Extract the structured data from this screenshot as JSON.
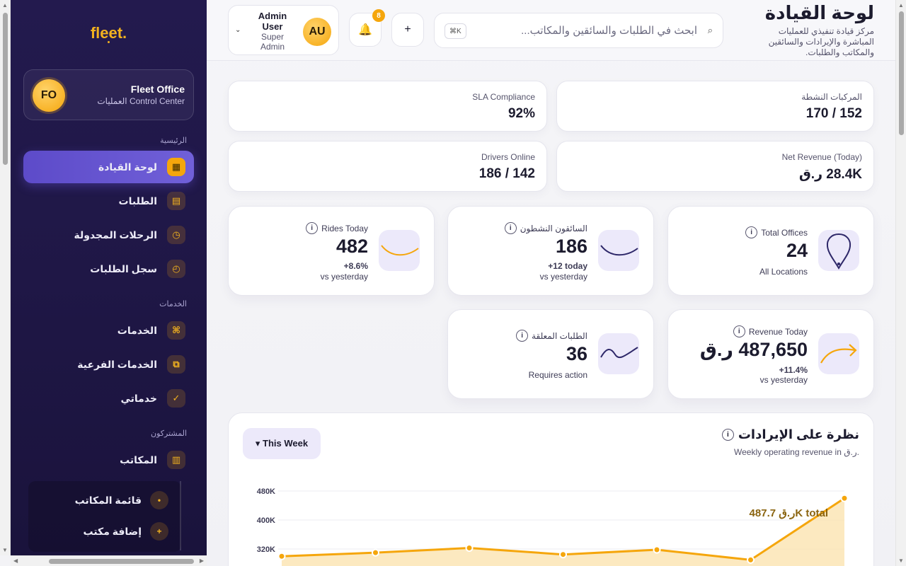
{
  "sidebar": {
    "logo": "fleet.",
    "office": {
      "initials": "FO",
      "name": "Fleet Office",
      "subtitle": "العمليات Control Center"
    },
    "sections": {
      "main": "الرئيسية",
      "services": "الخدمات",
      "subscribers": "المشتركون"
    },
    "items": {
      "dashboard": "لوحة القيادة",
      "requests": "الطلبات",
      "scheduled_trips": "الرحلات المجدولة",
      "request_log": "سجل الطلبات",
      "services": "الخدمات",
      "sub_services": "الخدمات الفرعية",
      "my_services": "خدماتي",
      "offices": "المكاتب",
      "offices_list": "قائمة المكاتب",
      "add_office": "إضافة مكتب"
    }
  },
  "header": {
    "title": "لوحة القيادة",
    "subtitle": "مركز قيادة تنفيذي للعمليات المباشرة والإيرادات والسائقين والمكاتب والطلبات.",
    "search_placeholder": "ابحث في الطلبات والسائقين والمكاتب...",
    "search_shortcut": "⌘K",
    "notification_count": "8",
    "user": {
      "initials": "AU",
      "name": "Admin User",
      "role": "Super Admin"
    }
  },
  "stats": {
    "active_vehicles": {
      "label": "المركبات النشطة",
      "value": "152 / 170"
    },
    "sla": {
      "label": "SLA Compliance",
      "value": "92%"
    },
    "net_revenue": {
      "label": "Net Revenue (Today)",
      "value": "28.4K ر.ق"
    },
    "drivers_online": {
      "label": "Drivers Online",
      "value": "142 / 186"
    }
  },
  "kpis": {
    "total_offices": {
      "label": "Total Offices",
      "value": "24",
      "sub": "All Locations"
    },
    "active_drivers": {
      "label": "السائقون النشطون",
      "value": "186",
      "change": "+12 today",
      "sub": "vs yesterday"
    },
    "rides_today": {
      "label": "Rides Today",
      "value": "482",
      "change": "+8.6%",
      "sub": "vs yesterday"
    },
    "revenue_today": {
      "label": "Revenue Today",
      "value": "487,650 ر.ق",
      "change": "+11.4%",
      "sub": "vs yesterday"
    },
    "pending_requests": {
      "label": "الطلبات المعلقة",
      "value": "36",
      "sub": "Requires action"
    }
  },
  "colors": {
    "accent": "#f5a60c",
    "sidebar": "#211849",
    "primary": "#5d4bc9"
  },
  "revenue": {
    "title": "نظرة على الإيرادات",
    "subtitle": "Weekly operating revenue in ر.ق.",
    "period": "▾ This Week",
    "total_label": "487.7 ر.قK total"
  },
  "chart_data": {
    "type": "area",
    "title": "نظرة على الإيرادات",
    "ylabel": "",
    "yticks": [
      "480K",
      "400K",
      "320K"
    ],
    "ylim": [
      320000,
      480000
    ],
    "x": [
      0,
      1,
      2,
      3,
      4,
      5,
      6
    ],
    "values": [
      300000,
      310000,
      323000,
      305000,
      318000,
      290000,
      460000
    ]
  }
}
